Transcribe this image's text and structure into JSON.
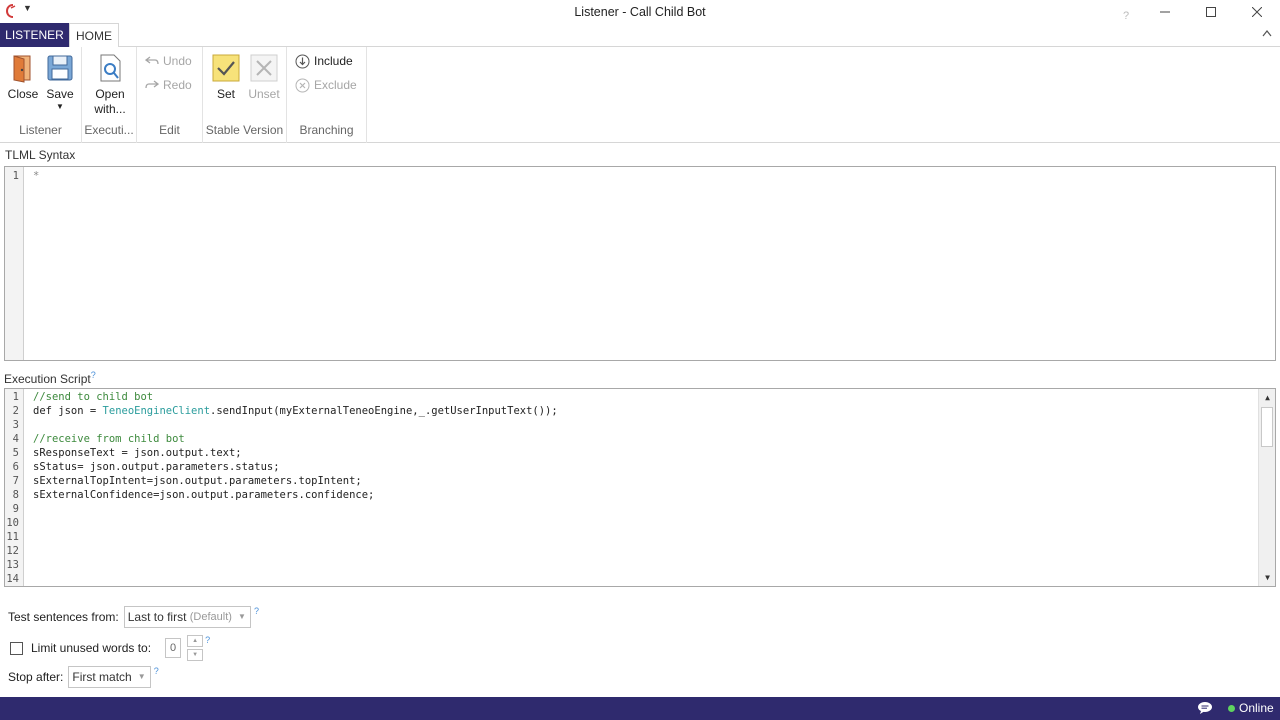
{
  "window": {
    "title": "Listener - Call Child Bot",
    "help_label": "?"
  },
  "ribbon": {
    "tabs": [
      {
        "label": "LISTENER",
        "active": false
      },
      {
        "label": "HOME",
        "active": true
      }
    ],
    "groups": {
      "listener": {
        "label": "Listener",
        "close_label": "Close",
        "save_label": "Save"
      },
      "execution": {
        "label": "Executi...",
        "open_with_line1": "Open",
        "open_with_line2": "with..."
      },
      "edit": {
        "label": "Edit",
        "undo_label": "Undo",
        "redo_label": "Redo"
      },
      "stable_version": {
        "label": "Stable Version",
        "set_label": "Set",
        "unset_label": "Unset"
      },
      "branching": {
        "label": "Branching",
        "include_label": "Include",
        "exclude_label": "Exclude"
      }
    }
  },
  "tlml": {
    "label": "TLML Syntax",
    "line_numbers": [
      "1"
    ],
    "lines": [
      "*"
    ]
  },
  "execution_script": {
    "label": "Execution Script",
    "help": "?",
    "line_numbers": [
      "1",
      "2",
      "3",
      "4",
      "5",
      "6",
      "7",
      "8",
      "9",
      "10",
      "11",
      "12",
      "13",
      "14"
    ],
    "lines": [
      {
        "kind": "comment",
        "text": "//send to child bot"
      },
      {
        "kind": "mixed",
        "pre": "def json = ",
        "type": "TeneoEngineClient",
        "post": ".sendInput(myExternalTeneoEngine,_.getUserInputText());"
      },
      {
        "kind": "plain",
        "text": ""
      },
      {
        "kind": "comment",
        "text": "//receive from child bot"
      },
      {
        "kind": "plain",
        "text": "sResponseText = json.output.text;"
      },
      {
        "kind": "plain",
        "text": "sStatus= json.output.parameters.status;"
      },
      {
        "kind": "plain",
        "text": "sExternalTopIntent=json.output.parameters.topIntent;"
      },
      {
        "kind": "plain",
        "text": "sExternalConfidence=json.output.parameters.confidence;"
      },
      {
        "kind": "plain",
        "text": ""
      },
      {
        "kind": "plain",
        "text": ""
      },
      {
        "kind": "plain",
        "text": ""
      },
      {
        "kind": "plain",
        "text": ""
      },
      {
        "kind": "plain",
        "text": ""
      },
      {
        "kind": "plain",
        "text": ""
      }
    ]
  },
  "options": {
    "test_sentences_label": "Test sentences from:",
    "test_sentences_value": "Last to first",
    "test_sentences_suffix": "(Default)",
    "limit_unused_label": "Limit unused words to:",
    "limit_unused_checked": false,
    "limit_unused_value": "0",
    "stop_after_label": "Stop after:",
    "stop_after_value": "First match",
    "help": "?"
  },
  "statusbar": {
    "online_label": "Online",
    "online_color": "#5fd35f"
  },
  "colors": {
    "accent": "#2f2a6e",
    "set_yellow": "#f7e27a"
  }
}
